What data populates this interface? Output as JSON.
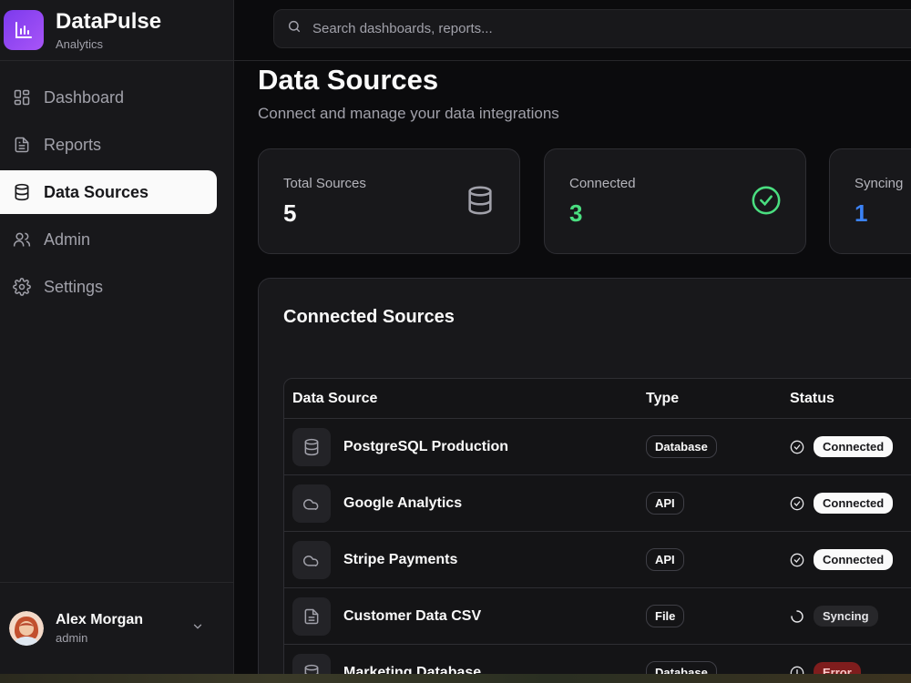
{
  "app": {
    "name": "DataPulse",
    "subtitle": "Analytics"
  },
  "search": {
    "placeholder": "Search dashboards, reports..."
  },
  "nav": [
    {
      "label": "Dashboard",
      "icon": "grid-icon",
      "active": false
    },
    {
      "label": "Reports",
      "icon": "document-icon",
      "active": false
    },
    {
      "label": "Data Sources",
      "icon": "database-icon",
      "active": true
    },
    {
      "label": "Admin",
      "icon": "users-icon",
      "active": false
    },
    {
      "label": "Settings",
      "icon": "gear-icon",
      "active": false
    }
  ],
  "user": {
    "name": "Alex Morgan",
    "role": "admin"
  },
  "page": {
    "title": "Data Sources",
    "subtitle": "Connect and manage your data integrations"
  },
  "stats": [
    {
      "label": "Total Sources",
      "value": "5",
      "color": "#fafafa",
      "icon": "database-icon"
    },
    {
      "label": "Connected",
      "value": "3",
      "color": "#4ade80",
      "icon": "check-circle-icon"
    },
    {
      "label": "Syncing",
      "value": "1",
      "color": "#3b82f6",
      "icon": "refresh-icon"
    }
  ],
  "panel": {
    "title": "Connected Sources",
    "columns": [
      "Data Source",
      "Type",
      "Status"
    ],
    "rows": [
      {
        "name": "PostgreSQL Production",
        "type": "Database",
        "status": "Connected",
        "icon": "database-icon"
      },
      {
        "name": "Google Analytics",
        "type": "API",
        "status": "Connected",
        "icon": "cloud-icon"
      },
      {
        "name": "Stripe Payments",
        "type": "API",
        "status": "Connected",
        "icon": "cloud-icon"
      },
      {
        "name": "Customer Data CSV",
        "type": "File",
        "status": "Syncing",
        "icon": "file-icon"
      },
      {
        "name": "Marketing Database",
        "type": "Database",
        "status": "Error",
        "icon": "database-icon"
      }
    ]
  },
  "colors": {
    "accent": "#8b5cf6",
    "connected": "#4ade80",
    "syncing": "#3b82f6",
    "error": "#7f1d1d"
  }
}
